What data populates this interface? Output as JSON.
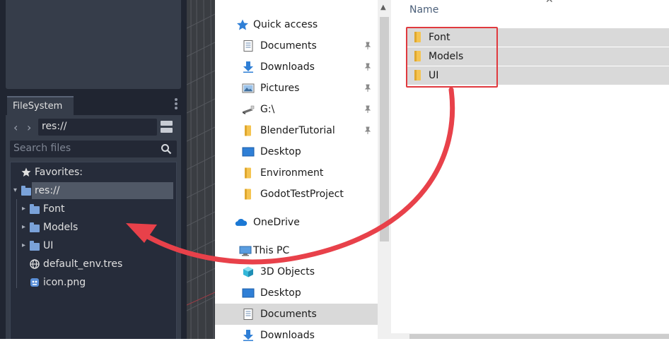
{
  "godot": {
    "dock_tab": "FileSystem",
    "path": "res://",
    "search_placeholder": "Search files",
    "tree": {
      "favorites": "Favorites:",
      "root": "res://",
      "items": [
        "Font",
        "Models",
        "UI",
        "default_env.tres",
        "icon.png"
      ]
    }
  },
  "explorer": {
    "nav": {
      "quick_access": "Quick access",
      "pinned": [
        "Documents",
        "Downloads",
        "Pictures",
        "G:\\",
        "BlenderTutorial"
      ],
      "recent": [
        "Desktop",
        "Environment",
        "GodotTestProject"
      ],
      "onedrive": "OneDrive",
      "this_pc": "This PC",
      "pc_items": [
        "3D Objects",
        "Desktop",
        "Documents",
        "Downloads"
      ]
    },
    "content": {
      "column_header": "Name",
      "folders": [
        "Font",
        "Models",
        "UI"
      ]
    }
  },
  "colors": {
    "godot_bg": "#202531",
    "godot_panel": "#363d4a",
    "godot_folder": "#7aa2d9",
    "explorer_selection": "#d9d9d9",
    "annotation_red": "#e8414a",
    "folder_yellow": "#f5c451"
  }
}
